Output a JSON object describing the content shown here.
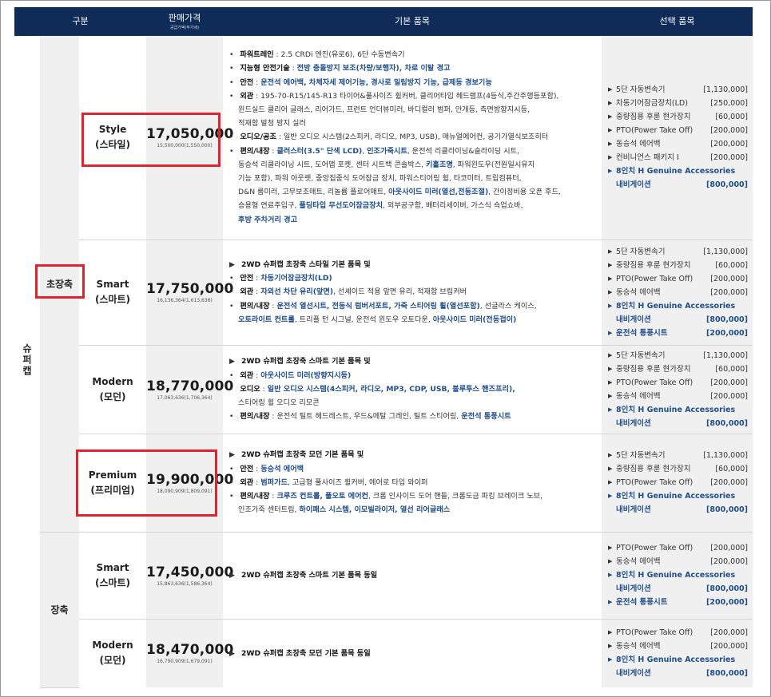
{
  "header": {
    "col_segment": "구분",
    "col_price": "판매가격",
    "col_price_sub": "공급가액(부가세)",
    "col_basic": "기본 품목",
    "col_options": "선택 품목"
  },
  "model": "슈퍼캡",
  "groups": {
    "g1": "초장축",
    "g2": "장축"
  },
  "rows": [
    {
      "trim": "Style",
      "trim_kr": "(스타일)",
      "price": "17,050,000",
      "price_sub": "15,500,000(1,550,000)",
      "features": [
        [
          [
            "• ",
            "b"
          ],
          [
            "파워트레인",
            "k"
          ],
          [
            " : 2.5 CRDi 엔진(유로6), 6단 수동변속기",
            ""
          ]
        ],
        [
          [
            "• ",
            "b"
          ],
          [
            "지능형 안전기술",
            "k"
          ],
          [
            " : ",
            ""
          ],
          [
            "전방 충돌방지 보조(차량/보행자), 차로 이탈 경고",
            "bl"
          ]
        ],
        [
          [
            "• ",
            "b"
          ],
          [
            "안전",
            "k"
          ],
          [
            " : ",
            ""
          ],
          [
            "운전석 에어백, 차체자세 제어기능, 경사로 밀림방지 기능, 급제동 경보기능",
            "bl"
          ]
        ],
        [
          [
            "• ",
            "b"
          ],
          [
            "외관",
            "k"
          ],
          [
            " : 195-70-R15/145-R13 타이어&풀사이즈 휠커버, 클리어타입 헤드램프(4등식,주간주행등포함),",
            ""
          ]
        ],
        [
          [
            "",
            "c"
          ],
          [
            "윈드실드 클리어 글래스, 리어가드, 프런트 언더뷰미러, 바디컬러 범퍼, 안개등, 측면방향지시등,",
            ""
          ]
        ],
        [
          [
            "",
            "c"
          ],
          [
            "적재함 발청 방지 실러",
            ""
          ]
        ],
        [
          [
            "• ",
            "b"
          ],
          [
            "오디오/공조",
            "k"
          ],
          [
            " : 일반 오디오 시스템(2스피커, 라디오, MP3, USB), 매뉴얼에어컨, 공기가열식보조히터",
            ""
          ]
        ],
        [
          [
            "• ",
            "b"
          ],
          [
            "편의/내장",
            "k"
          ],
          [
            " : ",
            ""
          ],
          [
            "클러스터(3.5\" 단색 LCD)",
            "bl"
          ],
          [
            ", ",
            ""
          ],
          [
            "인조가죽시트",
            "bl"
          ],
          [
            ", 운전석 리클라이닝&슬라이딩 시트,",
            ""
          ]
        ],
        [
          [
            "",
            "c"
          ],
          [
            "동승석 리클라이닝 시트, 도어맵 포켓, 센터 시트백 콘솔박스, ",
            ""
          ],
          [
            "키홀조명",
            "bl"
          ],
          [
            ", 파워윈도우(전원일시유지",
            ""
          ]
        ],
        [
          [
            "",
            "c"
          ],
          [
            "기능 포함), 파워 아웃렛, 중앙집중식 도어잠금 장치, 파워스티어링 휠, 타코미터, 트립컴퓨터,",
            ""
          ]
        ],
        [
          [
            "",
            "c"
          ],
          [
            "D&N 룸미러, 고무보조매트, 리놀륨 플로어매트, ",
            ""
          ],
          [
            "아웃사이드 미러(열선,전동조절)",
            "bl"
          ],
          [
            ", 간이정비용 오픈 후드,",
            ""
          ]
        ],
        [
          [
            "",
            "c"
          ],
          [
            "승용형 연료주입구, ",
            ""
          ],
          [
            "폴딩타입 무선도어잠금장치",
            "bl"
          ],
          [
            ", 외부공구함, 배터리세이버, 가스식 쇽업쇼바,",
            ""
          ]
        ],
        [
          [
            "",
            "c"
          ],
          [
            "후방 주차거리 경고",
            "bl"
          ]
        ]
      ],
      "options": [
        {
          "name": "5단 자동변속기",
          "price": "[1,130,000]",
          "blue": false
        },
        {
          "name": "차동기어잠금장치(LD)",
          "price": "[250,000]",
          "blue": false
        },
        {
          "name": "중량짐용 후륜 현가장치",
          "price": "[60,000]",
          "blue": false
        },
        {
          "name": "PTO(Power Take Off)",
          "price": "[200,000]",
          "blue": false
        },
        {
          "name": "동승석 에어백",
          "price": "[200,000]",
          "blue": false
        },
        {
          "name": "컨비니언스 패키지 Ⅰ",
          "price": "[200,000]",
          "blue": false
        },
        {
          "name": "8인치 H Genuine Accessories",
          "price": "",
          "blue": true
        },
        {
          "name": "내비게이션",
          "price": "[800,000]",
          "blue": true,
          "cont": true
        }
      ]
    },
    {
      "trim": "Smart",
      "trim_kr": "(스마트)",
      "price": "17,750,000",
      "price_sub": "16,136,364(1,613,636)",
      "features": [
        [
          [
            "▶ ",
            "b"
          ],
          [
            "2WD 슈퍼캡 초장축 스타일 기본 품목 및",
            "k"
          ]
        ],
        [
          [
            "• ",
            "b"
          ],
          [
            "안전",
            "k"
          ],
          [
            " : ",
            ""
          ],
          [
            "차동기어잠금장치(LD)",
            "bl"
          ]
        ],
        [
          [
            "• ",
            "b"
          ],
          [
            "외관",
            "k"
          ],
          [
            " : ",
            ""
          ],
          [
            "자외선 차단 유리(앞면)",
            "bl"
          ],
          [
            ", 선셰이드 적용 앞면 유리, 적재함 브림커버",
            ""
          ]
        ],
        [
          [
            "• ",
            "b"
          ],
          [
            "편의/내장",
            "k"
          ],
          [
            " : ",
            ""
          ],
          [
            "운전석 열선시트, 전동식 럼버서포트, 가죽 스티어링 휠(열선포함)",
            "bl"
          ],
          [
            ", 선글라스 케이스,",
            ""
          ]
        ],
        [
          [
            "",
            "c"
          ],
          [
            "오토라이트 컨트롤",
            "bl"
          ],
          [
            ", 트리플 턴 시그널, 운전석 윈도우 오토다운, ",
            ""
          ],
          [
            "아웃사이드 미러(전동접이)",
            "bl"
          ]
        ]
      ],
      "options": [
        {
          "name": "5단 자동변속기",
          "price": "[1,130,000]",
          "blue": false
        },
        {
          "name": "중량짐용 후륜 현가장치",
          "price": "[60,000]",
          "blue": false
        },
        {
          "name": "PTO(Power Take Off)",
          "price": "[200,000]",
          "blue": false
        },
        {
          "name": "동승석 에어백",
          "price": "[200,000]",
          "blue": false
        },
        {
          "name": "8인치 H Genuine Accessories",
          "price": "",
          "blue": true
        },
        {
          "name": "내비게이션",
          "price": "[800,000]",
          "blue": true,
          "cont": true
        },
        {
          "name": "운전석 통풍시트",
          "price": "[200,000]",
          "blue": true
        }
      ]
    },
    {
      "trim": "Modern",
      "trim_kr": "(모던)",
      "price": "18,770,000",
      "price_sub": "17,063,636(1,706,364)",
      "features": [
        [
          [
            "▶ ",
            "b"
          ],
          [
            "2WD 슈퍼캡 초장축 스마트 기본 품목 및",
            "k"
          ]
        ],
        [
          [
            "• ",
            "b"
          ],
          [
            "외관",
            "k"
          ],
          [
            " : ",
            ""
          ],
          [
            "아웃사이드 미러(방향지시등)",
            "bl"
          ]
        ],
        [
          [
            "• ",
            "b"
          ],
          [
            "오디오",
            "k"
          ],
          [
            " : ",
            ""
          ],
          [
            "일반 오디오 시스템(4스피커, 라디오, MP3, CDP, USB, 블루투스 핸즈프리),",
            "bl"
          ]
        ],
        [
          [
            "",
            "c"
          ],
          [
            "스티어링 휠 오디오 리모콘",
            ""
          ]
        ],
        [
          [
            "• ",
            "b"
          ],
          [
            "편의/내장",
            "k"
          ],
          [
            " : 운전석 틸트 헤드레스트, 우드&메탈 그레인, 틸트 스티어링, ",
            ""
          ],
          [
            "운전석 통풍시트",
            "bl"
          ]
        ]
      ],
      "options": [
        {
          "name": "5단 자동변속기",
          "price": "[1,130,000]",
          "blue": false
        },
        {
          "name": "중량짐용 후륜 현가장치",
          "price": "[60,000]",
          "blue": false
        },
        {
          "name": "PTO(Power Take Off)",
          "price": "[200,000]",
          "blue": false
        },
        {
          "name": "동승석 에어백",
          "price": "[200,000]",
          "blue": false
        },
        {
          "name": "8인치 H Genuine Accessories",
          "price": "",
          "blue": true
        },
        {
          "name": "내비게이션",
          "price": "[800,000]",
          "blue": true,
          "cont": true
        }
      ]
    },
    {
      "trim": "Premium",
      "trim_kr": "(프리미엄)",
      "price": "19,900,000",
      "price_sub": "18,090,909(1,809,091)",
      "features": [
        [
          [
            "▶ ",
            "b"
          ],
          [
            "2WD 슈퍼캡 초장축 모던 기본 품목 및",
            "k"
          ]
        ],
        [
          [
            "• ",
            "b"
          ],
          [
            "안전",
            "k"
          ],
          [
            " : ",
            ""
          ],
          [
            "동승석 에어백",
            "bl"
          ]
        ],
        [
          [
            "• ",
            "b"
          ],
          [
            "외관",
            "k"
          ],
          [
            " : ",
            ""
          ],
          [
            "범퍼가드",
            "bl"
          ],
          [
            ", 고급형 풀사이즈 휠커버, 에어로 타입 와이퍼",
            ""
          ]
        ],
        [
          [
            "• ",
            "b"
          ],
          [
            "편의/내장",
            "k"
          ],
          [
            " : ",
            ""
          ],
          [
            "크루즈 컨트롤, 풀오토 에어컨",
            "bl"
          ],
          [
            ", 크롬 인사이드 도어 핸들, 크롬도금 파킹 브레이크 노브,",
            ""
          ]
        ],
        [
          [
            "",
            "c"
          ],
          [
            "인조가죽 센터트림, ",
            ""
          ],
          [
            "하이패스 시스템, 이모빌라이저, 열선 리어글래스",
            "bl"
          ]
        ]
      ],
      "options": [
        {
          "name": "5단 자동변속기",
          "price": "[1,130,000]",
          "blue": false
        },
        {
          "name": "중량짐용 후륜 현가장치",
          "price": "[60,000]",
          "blue": false
        },
        {
          "name": "PTO(Power Take Off)",
          "price": "[200,000]",
          "blue": false
        },
        {
          "name": "8인치 H Genuine Accessories",
          "price": "",
          "blue": true
        },
        {
          "name": "내비게이션",
          "price": "[800,000]",
          "blue": true,
          "cont": true
        }
      ]
    },
    {
      "trim": "Smart",
      "trim_kr": "(스마트)",
      "price": "17,450,000",
      "price_sub": "15,863,636(1,586,364)",
      "features": [
        [
          [
            "▶ ",
            "b"
          ],
          [
            "2WD 슈퍼캡 초장축 스마트 기본 품목 동일",
            "k"
          ]
        ]
      ],
      "options": [
        {
          "name": "PTO(Power Take Off)",
          "price": "[200,000]",
          "blue": false
        },
        {
          "name": "동승석 에어백",
          "price": "[200,000]",
          "blue": false
        },
        {
          "name": "8인치 H Genuine Accessories",
          "price": "",
          "blue": true
        },
        {
          "name": "내비게이션",
          "price": "[800,000]",
          "blue": true,
          "cont": true
        },
        {
          "name": "운전석 통풍시트",
          "price": "[200,000]",
          "blue": true
        }
      ]
    },
    {
      "trim": "Modern",
      "trim_kr": "(모던)",
      "price": "18,470,000",
      "price_sub": "16,790,909(1,679,091)",
      "features": [
        [
          [
            "▶ ",
            "b"
          ],
          [
            "2WD 슈퍼캡 초장축 모던 기본 품목 동일",
            "k"
          ]
        ]
      ],
      "options": [
        {
          "name": "PTO(Power Take Off)",
          "price": "[200,000]",
          "blue": false
        },
        {
          "name": "동승석 에어백",
          "price": "[200,000]",
          "blue": false
        },
        {
          "name": "8인치 H Genuine Accessories",
          "price": "",
          "blue": true
        },
        {
          "name": "내비게이션",
          "price": "[800,000]",
          "blue": true,
          "cont": true
        }
      ]
    }
  ],
  "colors": {
    "header_bg": "#0f2b57",
    "highlight": "#e0232f",
    "accent_text": "#1f4e8c",
    "cell_gray": "#f0f0f0"
  }
}
